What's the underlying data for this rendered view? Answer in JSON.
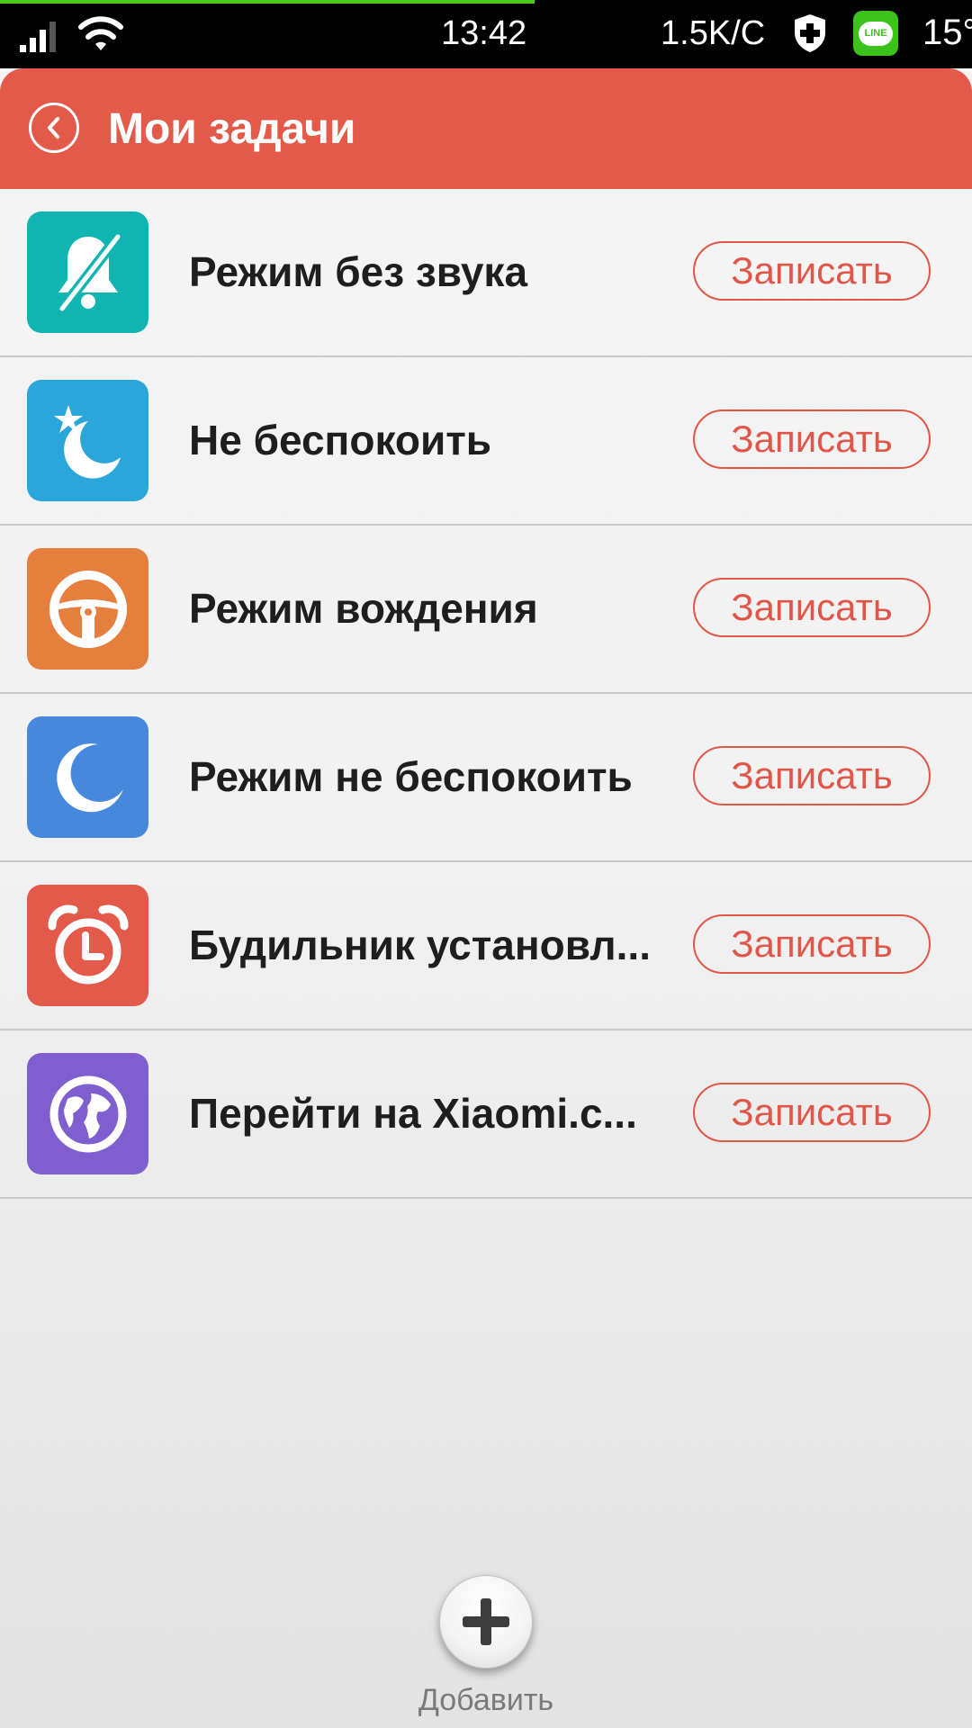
{
  "status_bar": {
    "time": "13:42",
    "network_speed": "1.5K/C",
    "temperature": "15°",
    "line_badge": "LINE",
    "page_load_progress": 0.55,
    "icons": [
      "signal-icon",
      "wifi-icon",
      "shield-icon",
      "line-app-icon"
    ]
  },
  "header": {
    "title": "Мои задачи",
    "background_color": "#e35a4a"
  },
  "tasks": [
    {
      "label": "Режим без звука",
      "icon": "silent-bell-icon",
      "icon_color": "#10b5b2",
      "button": "Записать"
    },
    {
      "label": "Не беспокоить",
      "icon": "moon-star-icon",
      "icon_color": "#2aa6da",
      "button": "Записать"
    },
    {
      "label": "Режим вождения",
      "icon": "steering-wheel-icon",
      "icon_color": "#e67e3e",
      "button": "Записать"
    },
    {
      "label": "Режим не беспокоить",
      "icon": "moon-icon",
      "icon_color": "#4688dc",
      "button": "Записать"
    },
    {
      "label": "Будильник установл...",
      "icon": "alarm-clock-icon",
      "icon_color": "#e35a4a",
      "button": "Записать"
    },
    {
      "label": "Перейти на Xiaomi.c...",
      "icon": "globe-icon",
      "icon_color": "#7f5fcf",
      "button": "Записать"
    }
  ],
  "add": {
    "label": "Добавить",
    "icon": "plus-icon"
  },
  "accent_color": "#e0574a"
}
